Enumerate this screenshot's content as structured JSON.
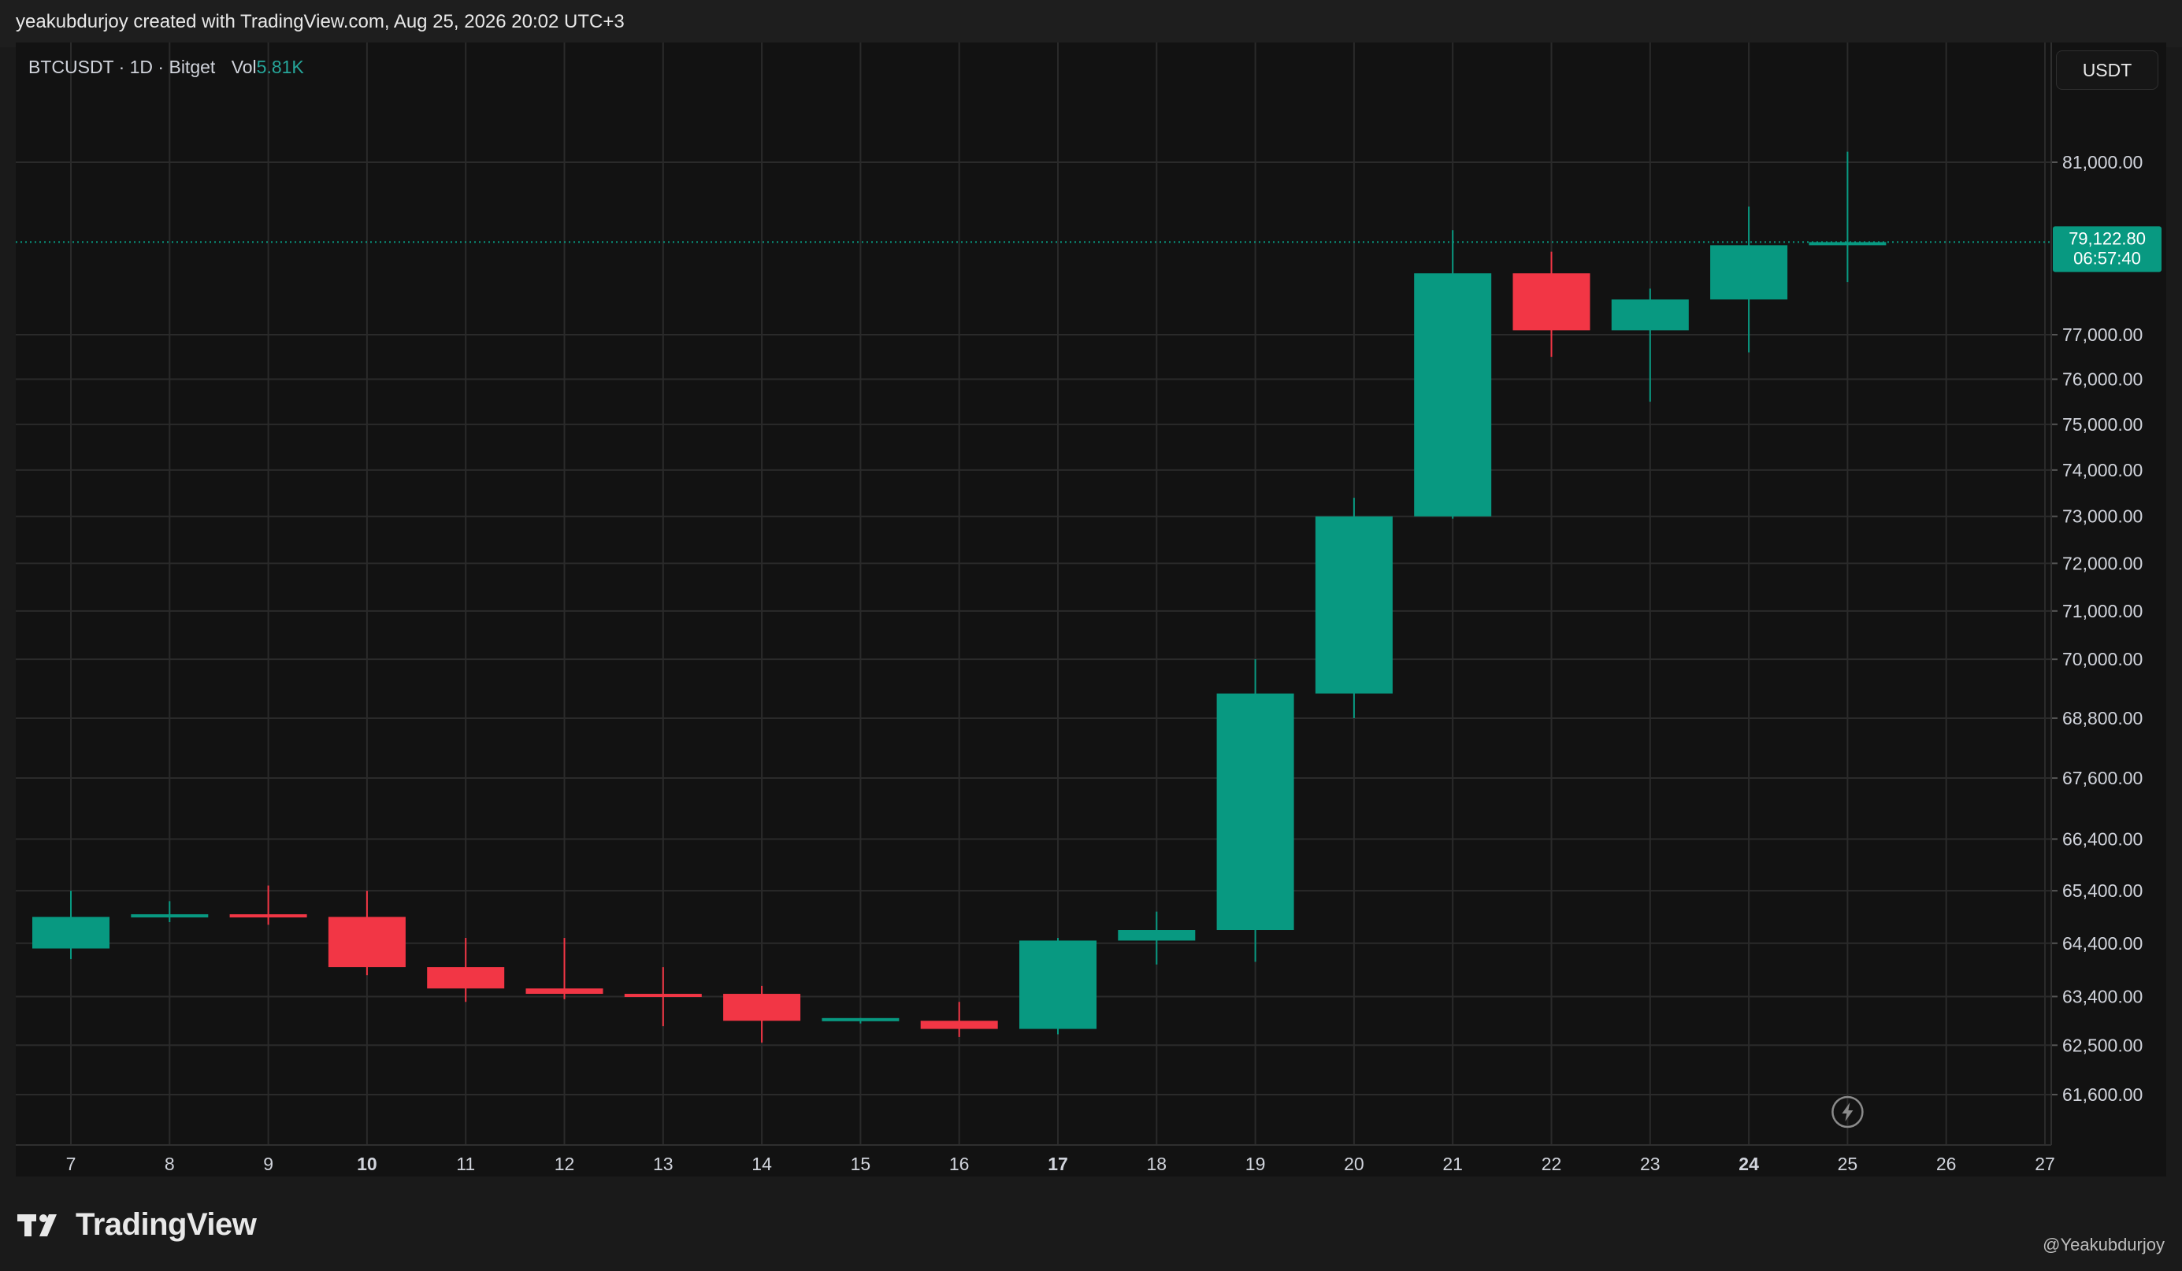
{
  "header": {
    "caption": "yeakubdurjoy created with TradingView.com, Aug 25, 2026 20:02 UTC+3"
  },
  "legend": {
    "symbol_text": "BTCUSDT · 1D · Bitget",
    "vol_label": "Vol",
    "vol_value": "5.81K"
  },
  "currency_button": "USDT",
  "footer": {
    "brand": "TradingView",
    "watermark_user": "@Yeakubdurjoy"
  },
  "colors": {
    "up": "#089981",
    "down": "#f23645",
    "grid": "#2a2a2a",
    "axis_text": "#d1d4dc",
    "price_line": "#089981"
  },
  "chart_data": {
    "type": "candlestick",
    "x_tick_labels": [
      "7",
      "8",
      "9",
      "10",
      "11",
      "12",
      "13",
      "14",
      "15",
      "16",
      "17",
      "18",
      "19",
      "20",
      "21",
      "22",
      "23",
      "24",
      "25",
      "26",
      "27"
    ],
    "bold_x_ticks": [
      "10",
      "17",
      "24"
    ],
    "y_tick_labels": [
      "81,000.00",
      "77,000.00",
      "76,000.00",
      "75,000.00",
      "74,000.00",
      "73,000.00",
      "72,000.00",
      "71,000.00",
      "70,000.00",
      "68,800.00",
      "67,600.00",
      "66,400.00",
      "65,400.00",
      "64,400.00",
      "63,400.00",
      "62,500.00",
      "61,600.00"
    ],
    "y_tick_values": [
      81000,
      77000,
      76000,
      75000,
      74000,
      73000,
      72000,
      71000,
      70000,
      68800,
      67600,
      66400,
      65400,
      64400,
      63400,
      62500,
      61600
    ],
    "log_scale": true,
    "grid": true,
    "current_price_label": "79,122.80",
    "countdown_label": "06:57:40",
    "current_price": 79122.8,
    "candles": [
      {
        "day": "7",
        "open": 64300,
        "high": 65400,
        "low": 64100,
        "close": 64900
      },
      {
        "day": "8",
        "open": 64900,
        "high": 65200,
        "low": 64800,
        "close": 64950
      },
      {
        "day": "9",
        "open": 64950,
        "high": 65500,
        "low": 64750,
        "close": 64900
      },
      {
        "day": "10",
        "open": 64900,
        "high": 65400,
        "low": 63800,
        "close": 63950
      },
      {
        "day": "11",
        "open": 63950,
        "high": 64500,
        "low": 63300,
        "close": 63550
      },
      {
        "day": "12",
        "open": 63550,
        "high": 64500,
        "low": 63350,
        "close": 63450
      },
      {
        "day": "13",
        "open": 63450,
        "high": 63950,
        "low": 62850,
        "close": 63400
      },
      {
        "day": "14",
        "open": 63450,
        "high": 63600,
        "low": 62550,
        "close": 62950
      },
      {
        "day": "15",
        "open": 62950,
        "high": 63000,
        "low": 62900,
        "close": 63000
      },
      {
        "day": "16",
        "open": 62950,
        "high": 63300,
        "low": 62650,
        "close": 62800
      },
      {
        "day": "17",
        "open": 62800,
        "high": 64500,
        "low": 62700,
        "close": 64450
      },
      {
        "day": "18",
        "open": 64450,
        "high": 65000,
        "low": 64000,
        "close": 64650
      },
      {
        "day": "19",
        "open": 64650,
        "high": 70000,
        "low": 64050,
        "close": 69300
      },
      {
        "day": "20",
        "open": 69300,
        "high": 73400,
        "low": 68800,
        "close": 73000
      },
      {
        "day": "21",
        "open": 73000,
        "high": 79400,
        "low": 72950,
        "close": 78400
      },
      {
        "day": "22",
        "open": 78400,
        "high": 78900,
        "low": 76500,
        "close": 77100
      },
      {
        "day": "23",
        "open": 77100,
        "high": 78050,
        "low": 75500,
        "close": 77800
      },
      {
        "day": "24",
        "open": 77800,
        "high": 79950,
        "low": 76600,
        "close": 79050
      },
      {
        "day": "25",
        "open": 79050,
        "high": 81250,
        "low": 78200,
        "close": 79122.8
      }
    ]
  }
}
